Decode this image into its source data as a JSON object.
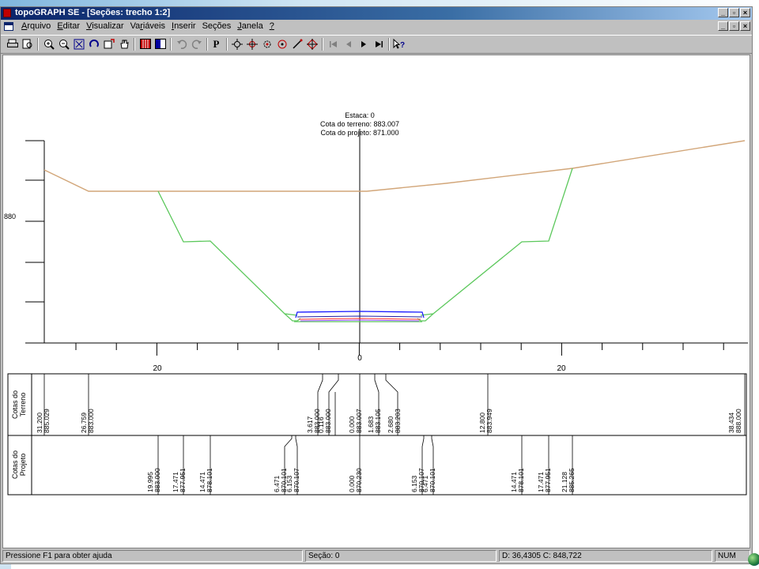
{
  "window": {
    "title": "topoGRAPH SE - [Seções: trecho 1:2]",
    "caption_buttons": [
      "_",
      "▫",
      "×"
    ]
  },
  "menubar": {
    "items": [
      {
        "label": "Arquivo",
        "mnemonic": "A"
      },
      {
        "label": "Editar",
        "mnemonic": "E"
      },
      {
        "label": "Visualizar",
        "mnemonic": "V"
      },
      {
        "label": "Variáveis",
        "mnemonic": "r"
      },
      {
        "label": "Inserir",
        "mnemonic": "I"
      },
      {
        "label": "Seções",
        "mnemonic": ""
      },
      {
        "label": "Janela",
        "mnemonic": "J"
      },
      {
        "label": "?",
        "mnemonic": "?"
      }
    ]
  },
  "toolbar": {
    "icons": [
      "print-icon",
      "print-preview-icon",
      "zoom-in-icon",
      "zoom-out-icon",
      "zoom-extents-icon",
      "redraw-icon",
      "zoom-window-icon",
      "pan-hand-icon",
      "table-icon",
      "panel-icon",
      "undo-icon",
      "redo-icon",
      "p-icon",
      "snap-point-icon",
      "snap-crosshair-icon",
      "snap-gear-icon",
      "snap-circle-icon",
      "draw-line-icon",
      "snap-target-icon",
      "first-icon",
      "previous-icon",
      "next-icon",
      "last-icon",
      "help-pointer-icon"
    ],
    "p_label": "P"
  },
  "drawing": {
    "info_lines": [
      "Estaca: 0",
      "Cota do terreno: 883.007",
      "Cota do projeto: 871.000"
    ],
    "y_axis_label": "880",
    "x_axis_labels": [
      "20",
      "0",
      "20"
    ],
    "colors": {
      "terrain": "#d2a679",
      "slope": "#5cc85c",
      "pavement_top": "#1a1aff",
      "pavement_mid": "#ff3333",
      "pavement_low": "#a050ff",
      "axis": "#000000"
    },
    "table": {
      "row1_label": "Cotas do\nTerreno",
      "row2_label": "Cotas do\nProjeto",
      "terreno": [
        [
          "31.200",
          "885.029"
        ],
        [
          "26.759",
          "883.000"
        ],
        [
          "3.617",
          "883.000"
        ],
        [
          "0.116",
          "883.000"
        ],
        [
          "0.000",
          "883.007"
        ],
        [
          "1.683",
          "883.105"
        ],
        [
          "2.680",
          "883.203"
        ],
        [
          "12.800",
          "883.949"
        ],
        [
          "38.434",
          "888.000"
        ]
      ],
      "projeto": [
        [
          "19.995",
          "883.000"
        ],
        [
          "17.471",
          "877.951"
        ],
        [
          "14.471",
          "878.101"
        ],
        [
          "6.471",
          "870.101"
        ],
        [
          "6.153",
          "870.107"
        ],
        [
          "0.000",
          "870.230"
        ],
        [
          "6.153",
          "870.107"
        ],
        [
          "6.471",
          "870.101"
        ],
        [
          "14.471",
          "878.101"
        ],
        [
          "17.471",
          "877.951"
        ],
        [
          "21.128",
          "885.265"
        ]
      ]
    }
  },
  "statusbar": {
    "help": "Pressione F1 para obter ajuda",
    "section": "Seção: 0",
    "coords": "D: 36,4305 C: 848,722",
    "num": "NUM"
  }
}
